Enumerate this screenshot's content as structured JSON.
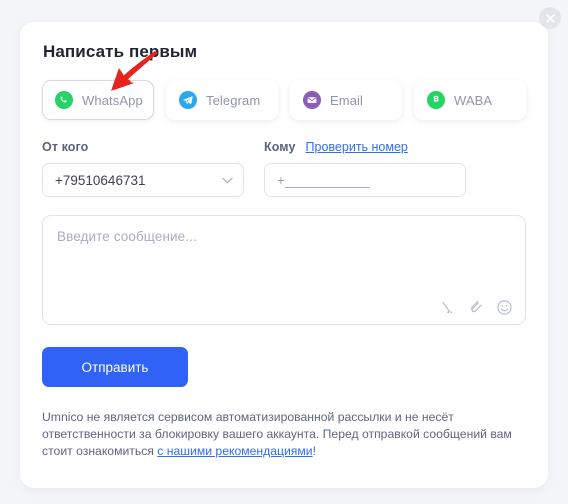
{
  "window": {
    "close_icon": "close-icon"
  },
  "card": {
    "title": "Написать первым"
  },
  "tabs": [
    {
      "label": "WhatsApp",
      "icon": "whatsapp-icon",
      "color": "#25D366",
      "selected": true
    },
    {
      "label": "Telegram",
      "icon": "telegram-icon",
      "color": "#29A9EB",
      "selected": false
    },
    {
      "label": "Email",
      "icon": "email-icon",
      "color": "#8B5CB8",
      "selected": false
    },
    {
      "label": "WABA",
      "icon": "waba-icon",
      "color": "#25D366",
      "selected": false
    }
  ],
  "from_field": {
    "label": "От кого",
    "value": "+79510646731",
    "chevron_icon": "chevron-down-icon"
  },
  "to_field": {
    "label": "Кому",
    "check_link": "Проверить номер",
    "placeholder": "+___________"
  },
  "message": {
    "placeholder": "Введите сообщение...",
    "tools": [
      {
        "name": "quick-reply-icon"
      },
      {
        "name": "attachment-icon"
      },
      {
        "name": "emoji-icon"
      }
    ]
  },
  "send": {
    "label": "Отправить",
    "color": "#2f62f5"
  },
  "disclaimer": {
    "text_before": "Umnico не является сервисом автоматизированной рассылки и не несёт ответственности за блокировку вашего аккаунта. Перед отправкой сообщений вам стоит ознакомиться ",
    "link": "с нашими рекомендациями",
    "text_after": "!"
  },
  "annotation": {
    "arrow": "red-arrow-pointer",
    "color": "#e8231f"
  }
}
